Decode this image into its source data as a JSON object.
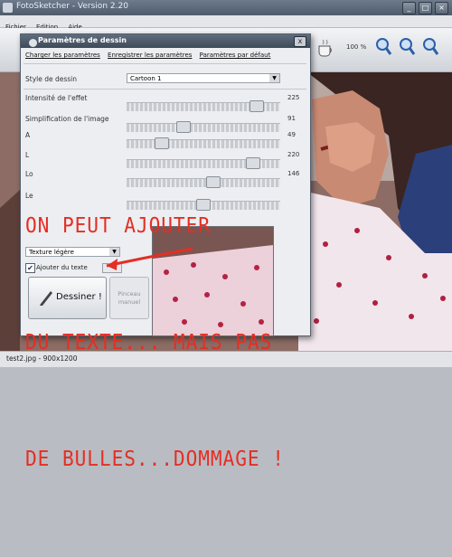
{
  "app": {
    "title": "FotoSketcher - Version 2.20",
    "menu": [
      "Fichier",
      "Edition",
      "Aide"
    ],
    "zoom_label": "100 %"
  },
  "dialog": {
    "title": "Paramètres de dessin",
    "close_label": "x",
    "links": [
      "Charger les paramètres",
      "Enregistrer les paramètres",
      "Paramètres par défaut"
    ],
    "style_label": "Style de dessin",
    "style_value": "Cartoon 1",
    "params": [
      {
        "label": "Intensité de l'effet",
        "value": 225,
        "fraction": 0.88
      },
      {
        "label": "Simplification de l'image",
        "value": 91,
        "fraction": 0.36
      },
      {
        "label": "A",
        "value": 49,
        "fraction": 0.2
      },
      {
        "label": "L",
        "value": 220,
        "fraction": 0.86
      },
      {
        "label": "Lo",
        "value": 146,
        "fraction": 0.57
      },
      {
        "label": "Le",
        "value": "",
        "fraction": 0.5
      }
    ],
    "texture_value": "Texture légère",
    "checkbox_label": "Ajouter du texte",
    "checkbox_mark": "✔",
    "draw_button": "Dessiner !",
    "brush_button_line1": "Pinceau",
    "brush_button_line2": "manuel"
  },
  "statusbar": {
    "text": "test2.jpg - 900x1200"
  },
  "annotation": {
    "lines": [
      "ON PEUT AJOUTER",
      "DU TEXTE... MAIS PAS",
      "DE BULLES...DOMMAGE !"
    ],
    "color": "#e52e24"
  },
  "colors": {
    "accent": "#3f6fb5",
    "dialog_title": "#3e4a58"
  }
}
